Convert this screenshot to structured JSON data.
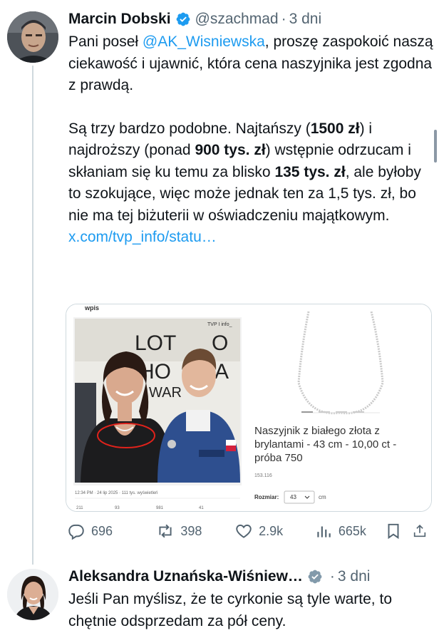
{
  "tweet1": {
    "author_name": "Marcin Dobski",
    "handle": "@szachmad",
    "separator": "·",
    "time": "3 dni",
    "text_part1": "Pani poseł ",
    "mention": "@AK_Wisniewska",
    "text_part2": ", proszę zaspokoić naszą ciekawość i ujawnić, która cena naszyjnika jest zgodna z prawdą.",
    "p2_a": "Są trzy bardzo podobne. Najtańszy (",
    "p2_b1": "1500 zł",
    "p2_c": ") i najdroższy (ponad ",
    "p2_b2": "900 tys. zł",
    "p2_d": ") wstępnie odrzucam i skłaniam się ku temu za blisko ",
    "p2_b3": "135 tys. zł",
    "p2_e": ", ale byłoby to szokujące, więc może jednak ten za 1,5 tys. zł, bo nie ma tej biżuterii w oświadczeniu majątkowym.",
    "link": "x.com/tvp_info/statu…",
    "media": {
      "left_header": "wpis",
      "tvp_label": "TVP I info_",
      "sign_line1": "LOT",
      "sign_line1b": "O",
      "sign_line2": "HO",
      "sign_line2b": "A",
      "sign_line3": "WAR",
      "caption": "12:34 PM · 24 lip 2025 · 111 tys. wyświetleń",
      "small_stats": [
        "211",
        "93",
        "981",
        "41"
      ],
      "product_title": "Naszyjnik z białego złota z brylantami - 43 cm - 10,00 ct - próba 750",
      "product_code": "153.116",
      "size_label": "Rozmiar:",
      "size_value": "43",
      "size_unit": "cm"
    },
    "stats": {
      "replies": "696",
      "reposts": "398",
      "likes": "2.9k",
      "views": "665k"
    }
  },
  "tweet2": {
    "author_name": "Aleksandra Uznańska-Wiśniew…",
    "separator": "·",
    "time": "3 dni",
    "text": "Jeśli Pan myślisz, że te cyrkonie są tyle warte, to chętnie odsprzedam za pół ceny."
  },
  "colors": {
    "accent": "#1d9bf0",
    "secondary_text": "#536471",
    "circle_annotation": "#e0221b"
  }
}
